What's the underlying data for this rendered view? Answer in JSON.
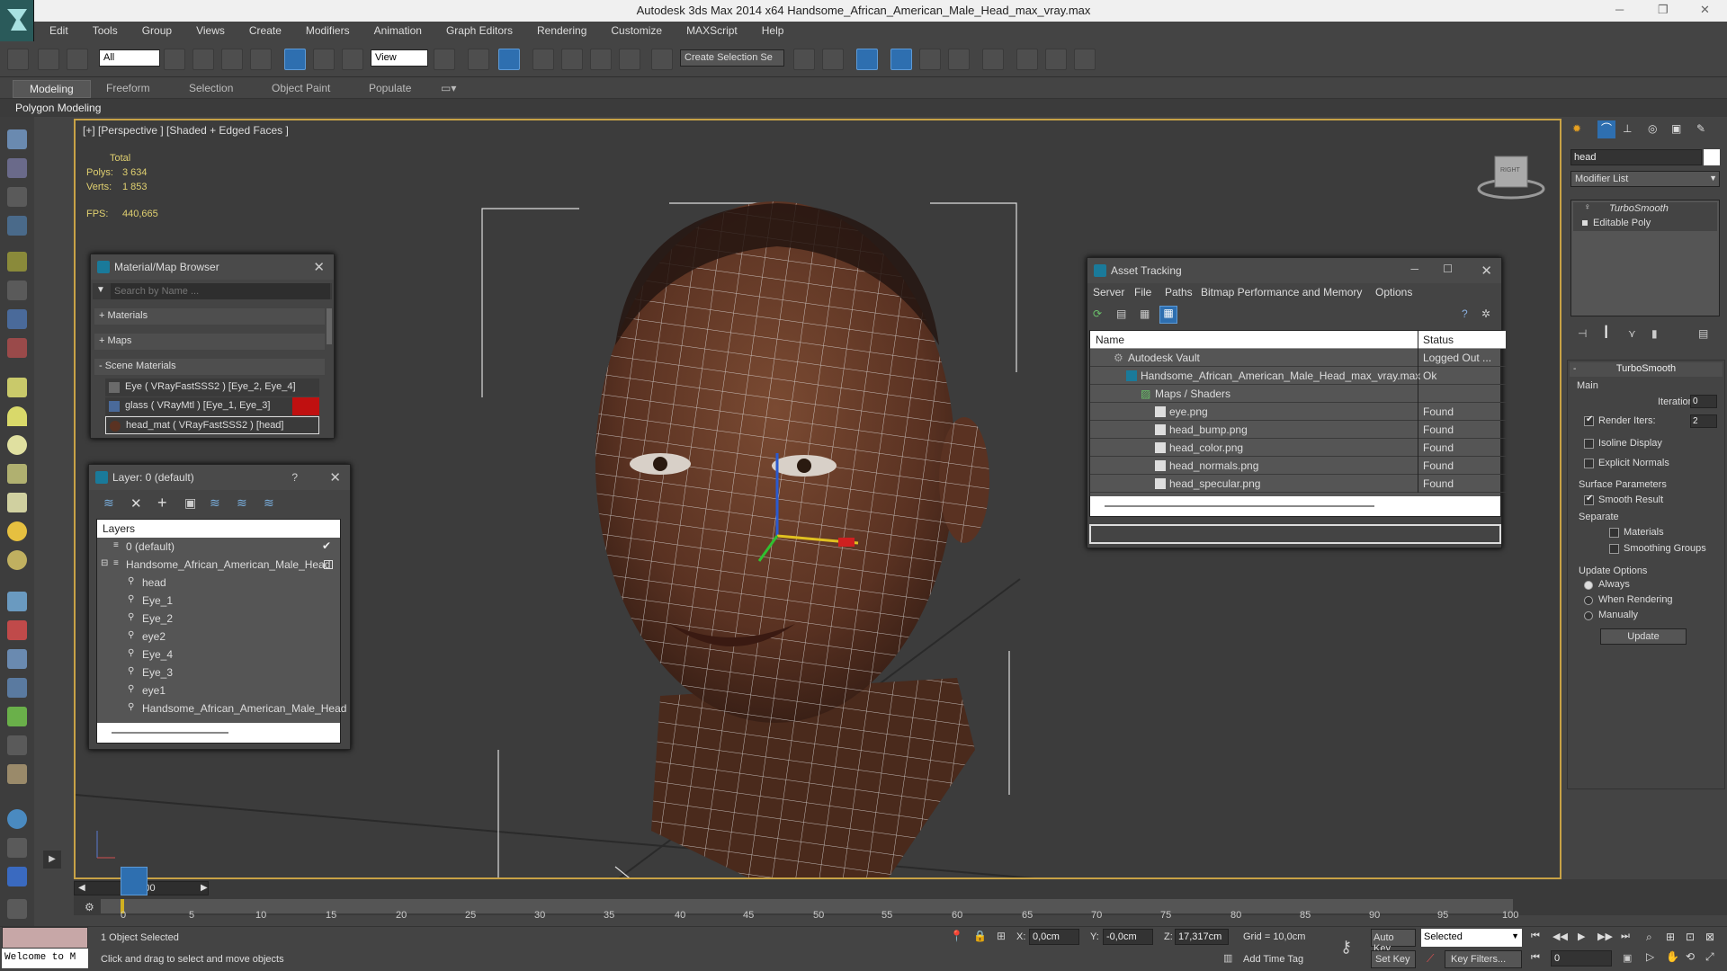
{
  "title": "Autodesk 3ds Max  2014 x64     Handsome_African_American_Male_Head_max_vray.max",
  "menu": [
    "Edit",
    "Tools",
    "Group",
    "Views",
    "Create",
    "Modifiers",
    "Animation",
    "Graph Editors",
    "Rendering",
    "Customize",
    "MAXScript",
    "Help"
  ],
  "toolbar": {
    "filter": "All",
    "refcoord": "View",
    "selset": "Create Selection Se"
  },
  "ribbon": {
    "tabs": [
      "Modeling",
      "Freeform",
      "Selection",
      "Object Paint",
      "Populate"
    ],
    "sub": "Polygon Modeling"
  },
  "viewport": {
    "label": "[+] [Perspective ] [Shaded + Edged Faces ]",
    "stats": {
      "total": "Total",
      "polys_label": "Polys:",
      "polys": "3 634",
      "verts_label": "Verts:",
      "verts": "1 853",
      "fps_label": "FPS:",
      "fps": "440,665"
    },
    "cube_label": "RIGHT"
  },
  "matbrowser": {
    "title": "Material/Map Browser",
    "search": "Search by Name ...",
    "groups": [
      "+ Materials",
      "+ Maps",
      "- Scene Materials"
    ],
    "items": [
      "Eye  ( VRayFastSSS2 ) [Eye_2, Eye_4]",
      "glass  ( VRayMtl ) [Eye_1, Eye_3]",
      "head_mat  ( VRayFastSSS2 ) [head]"
    ]
  },
  "layers": {
    "title": "Layer: 0 (default)",
    "help": "?",
    "header": "Layers",
    "rows": [
      "0 (default)",
      "Handsome_African_American_Male_Head",
      "head",
      "Eye_1",
      "Eye_2",
      "eye2",
      "Eye_4",
      "Eye_3",
      "eye1",
      "Handsome_African_American_Male_Head"
    ]
  },
  "asset": {
    "title": "Asset Tracking",
    "menu": [
      "Server",
      "File",
      "Paths",
      "Bitmap Performance and Memory",
      "Options"
    ],
    "col_name": "Name",
    "col_status": "Status",
    "rows": [
      {
        "name": "Autodesk Vault",
        "status": "Logged Out ..."
      },
      {
        "name": "Handsome_African_American_Male_Head_max_vray.max",
        "status": "Ok"
      },
      {
        "name": "Maps / Shaders",
        "status": ""
      },
      {
        "name": "eye.png",
        "status": "Found"
      },
      {
        "name": "head_bump.png",
        "status": "Found"
      },
      {
        "name": "head_color.png",
        "status": "Found"
      },
      {
        "name": "head_normals.png",
        "status": "Found"
      },
      {
        "name": "head_specular.png",
        "status": "Found"
      }
    ]
  },
  "cmd": {
    "objname": "head",
    "modlist": "Modifier List",
    "stack": [
      "TurboSmooth",
      "Editable Poly"
    ],
    "rollout": "TurboSmooth",
    "main": "Main",
    "iter_label": "Iterations:",
    "iter": "0",
    "render_label": "Render Iters:",
    "render": "2",
    "isoline": "Isoline Display",
    "explicit": "Explicit Normals",
    "surface": "Surface Parameters",
    "smooth": "Smooth Result",
    "separate": "Separate",
    "materials": "Materials",
    "smoothgroups": "Smoothing Groups",
    "update_opts": "Update Options",
    "always": "Always",
    "when": "When Rendering",
    "manually": "Manually",
    "update": "Update"
  },
  "timeline": {
    "frame": "0 / 100",
    "ticks": [
      "0",
      "5",
      "10",
      "15",
      "20",
      "25",
      "30",
      "35",
      "40",
      "45",
      "50",
      "55",
      "60",
      "65",
      "70",
      "75",
      "80",
      "85",
      "90",
      "95",
      "100"
    ]
  },
  "status": {
    "welcome": "Welcome to M",
    "selected": "1 Object Selected",
    "prompt": "Click and drag to select and move objects",
    "x_label": "X:",
    "x": "0,0cm",
    "y_label": "Y:",
    "y": "-0,0cm",
    "z_label": "Z:",
    "z": "17,317cm",
    "grid": "Grid = 10,0cm",
    "addtime": "Add Time Tag",
    "autokey": "Auto Key",
    "setkey": "Set Key",
    "keymode": "Selected",
    "keyfilters": "Key Filters...",
    "frame": "0"
  }
}
